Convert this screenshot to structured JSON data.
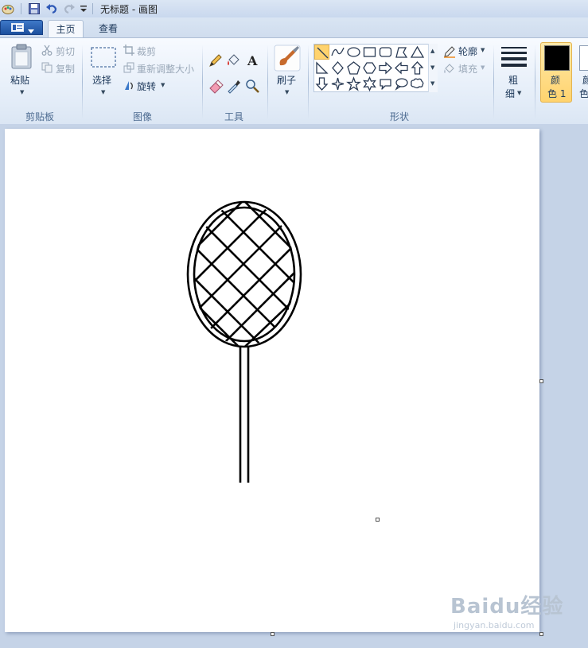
{
  "window": {
    "title": "无标题 - 画图"
  },
  "tabs": [
    {
      "label": "主页"
    },
    {
      "label": "查看"
    }
  ],
  "ribbon": {
    "clipboard": {
      "paste_label": "粘贴",
      "cut_label": "剪切",
      "copy_label": "复制",
      "group_label": "剪贴板"
    },
    "image": {
      "select_label": "选择",
      "crop_label": "裁剪",
      "resize_label": "重新调整大小",
      "rotate_label": "旋转",
      "group_label": "图像"
    },
    "tools": {
      "group_label": "工具"
    },
    "brushes": {
      "label": "刷子"
    },
    "shapes": {
      "outline_label": "轮廓",
      "fill_label": "填充",
      "group_label": "形状"
    },
    "size": {
      "label_line1": "粗",
      "label_line2": "细"
    },
    "colors": {
      "color1_line1": "颜",
      "color1_line2": "色 1",
      "color2_line1": "颜",
      "color2_line2": "色",
      "color1_value": "#000000",
      "color2_value": "#ffffff"
    }
  },
  "watermark": {
    "text": "Baidu经验",
    "sub": "jingyan.baidu.com"
  }
}
